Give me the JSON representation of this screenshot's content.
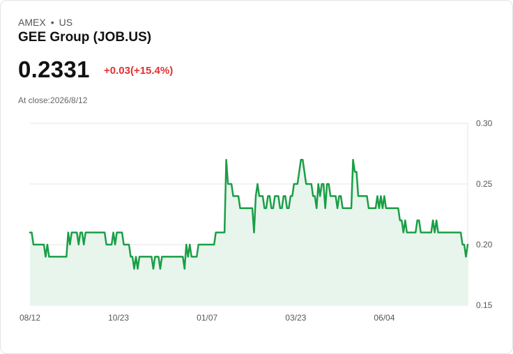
{
  "header": {
    "exchange": "AMEX",
    "separator": "•",
    "region": "US",
    "company_name": "GEE Group (JOB.US)",
    "price": "0.2331",
    "change": "+0.03(+15.4%)",
    "close_label": "At close:2026/8/12"
  },
  "colors": {
    "line": "#1a9e46",
    "area": "#e8f5ec",
    "change": "#e03131",
    "grid": "#e6e6e6"
  },
  "chart_data": {
    "type": "area",
    "title": "",
    "xlabel": "",
    "ylabel": "",
    "ylim": [
      0.15,
      0.3
    ],
    "yticks": [
      "0.30",
      "0.25",
      "0.20",
      "0.15"
    ],
    "xticks": [
      "08/12",
      "10/23",
      "01/07",
      "03/23",
      "06/04"
    ],
    "xtick_index": [
      0,
      51,
      102,
      153,
      204
    ],
    "grid": true,
    "series": [
      {
        "values": [
          0.21,
          0.21,
          0.2,
          0.2,
          0.2,
          0.2,
          0.2,
          0.2,
          0.2,
          0.19,
          0.2,
          0.19,
          0.19,
          0.19,
          0.19,
          0.19,
          0.19,
          0.19,
          0.19,
          0.19,
          0.19,
          0.19,
          0.21,
          0.2,
          0.21,
          0.21,
          0.21,
          0.21,
          0.2,
          0.21,
          0.21,
          0.2,
          0.21,
          0.21,
          0.21,
          0.21,
          0.21,
          0.21,
          0.21,
          0.21,
          0.21,
          0.21,
          0.21,
          0.21,
          0.2,
          0.2,
          0.2,
          0.2,
          0.21,
          0.2,
          0.21,
          0.21,
          0.21,
          0.21,
          0.2,
          0.2,
          0.2,
          0.2,
          0.19,
          0.19,
          0.18,
          0.19,
          0.18,
          0.19,
          0.19,
          0.19,
          0.19,
          0.19,
          0.19,
          0.19,
          0.19,
          0.18,
          0.19,
          0.19,
          0.19,
          0.18,
          0.19,
          0.19,
          0.19,
          0.19,
          0.19,
          0.19,
          0.19,
          0.19,
          0.19,
          0.19,
          0.19,
          0.19,
          0.19,
          0.18,
          0.2,
          0.19,
          0.2,
          0.19,
          0.19,
          0.19,
          0.19,
          0.2,
          0.2,
          0.2,
          0.2,
          0.2,
          0.2,
          0.2,
          0.2,
          0.2,
          0.2,
          0.21,
          0.21,
          0.21,
          0.21,
          0.21,
          0.21,
          0.27,
          0.25,
          0.25,
          0.25,
          0.24,
          0.24,
          0.24,
          0.24,
          0.23,
          0.23,
          0.23,
          0.23,
          0.23,
          0.23,
          0.23,
          0.23,
          0.21,
          0.24,
          0.25,
          0.24,
          0.24,
          0.24,
          0.23,
          0.23,
          0.24,
          0.24,
          0.23,
          0.23,
          0.24,
          0.24,
          0.24,
          0.23,
          0.23,
          0.24,
          0.24,
          0.23,
          0.23,
          0.24,
          0.24,
          0.25,
          0.25,
          0.25,
          0.26,
          0.27,
          0.27,
          0.26,
          0.25,
          0.25,
          0.25,
          0.25,
          0.24,
          0.24,
          0.23,
          0.25,
          0.24,
          0.25,
          0.25,
          0.23,
          0.25,
          0.25,
          0.24,
          0.24,
          0.24,
          0.24,
          0.23,
          0.24,
          0.24,
          0.23,
          0.23,
          0.23,
          0.23,
          0.23,
          0.23,
          0.27,
          0.26,
          0.26,
          0.24,
          0.24,
          0.24,
          0.24,
          0.24,
          0.24,
          0.23,
          0.23,
          0.23,
          0.23,
          0.23,
          0.24,
          0.23,
          0.24,
          0.23,
          0.24,
          0.23,
          0.23,
          0.23,
          0.23,
          0.23,
          0.23,
          0.23,
          0.23,
          0.22,
          0.22,
          0.21,
          0.22,
          0.21,
          0.21,
          0.21,
          0.21,
          0.21,
          0.21,
          0.22,
          0.22,
          0.21,
          0.21,
          0.21,
          0.21,
          0.21,
          0.21,
          0.21,
          0.22,
          0.21,
          0.22,
          0.21,
          0.21,
          0.21,
          0.21,
          0.21,
          0.21,
          0.21,
          0.21,
          0.21,
          0.21,
          0.21,
          0.21,
          0.21,
          0.21,
          0.2,
          0.2,
          0.19,
          0.2
        ]
      }
    ]
  }
}
